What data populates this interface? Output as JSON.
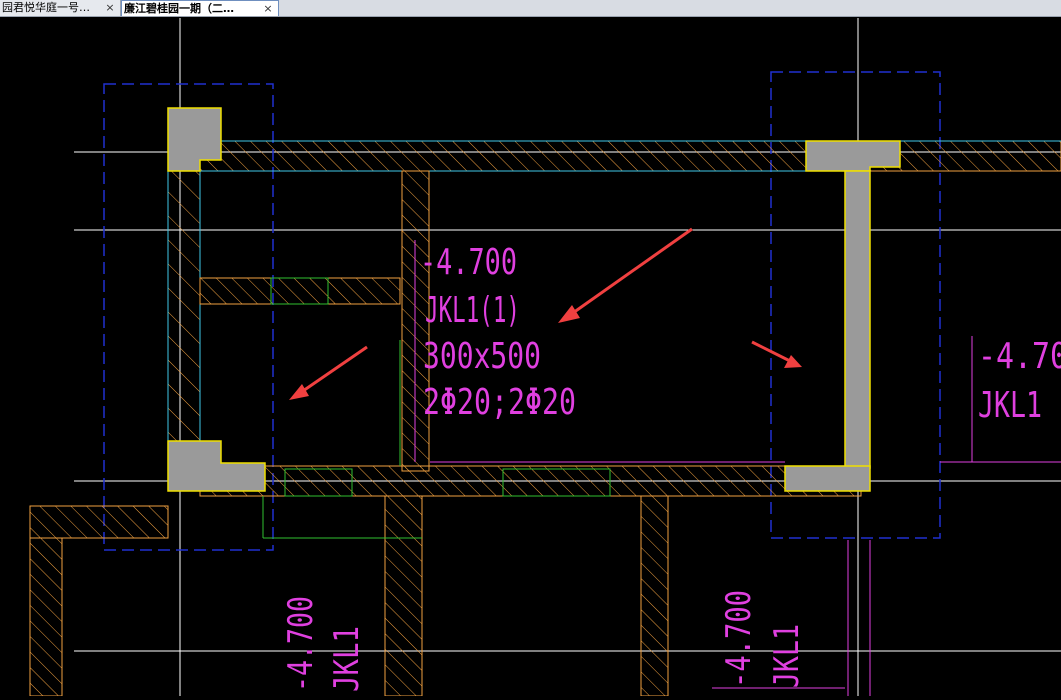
{
  "tabs": [
    {
      "label": "园君悦华庭一号…",
      "close": "×",
      "active": false
    },
    {
      "label": "廉江碧桂园一期（二…",
      "close": "×",
      "active": true
    }
  ],
  "drawing": {
    "center_annotation": {
      "elevation": "-4.700",
      "beam_name": "JKL1(1)",
      "section": "300x500",
      "rebar": "2Φ20;2Φ20"
    },
    "right_annotation": {
      "elevation": "-4.70",
      "beam_name": "JKL1"
    },
    "bottom_left_annotation": {
      "elevation": "-4.700",
      "beam_name": "JKL1"
    },
    "bottom_right_annotation": {
      "elevation": "-4.700",
      "beam_name": "JKL1"
    },
    "colors": {
      "background": "#000000",
      "wall_outline": "#f0a040",
      "annotation": "#e040e0",
      "column": "#9a9a9a",
      "column_border": "#f0e000",
      "axis": "#ffffff",
      "dashed_grid": "#2030d0",
      "cyan_line": "#40c8e8",
      "green_line": "#30c030",
      "arrow": "#f04040"
    }
  }
}
